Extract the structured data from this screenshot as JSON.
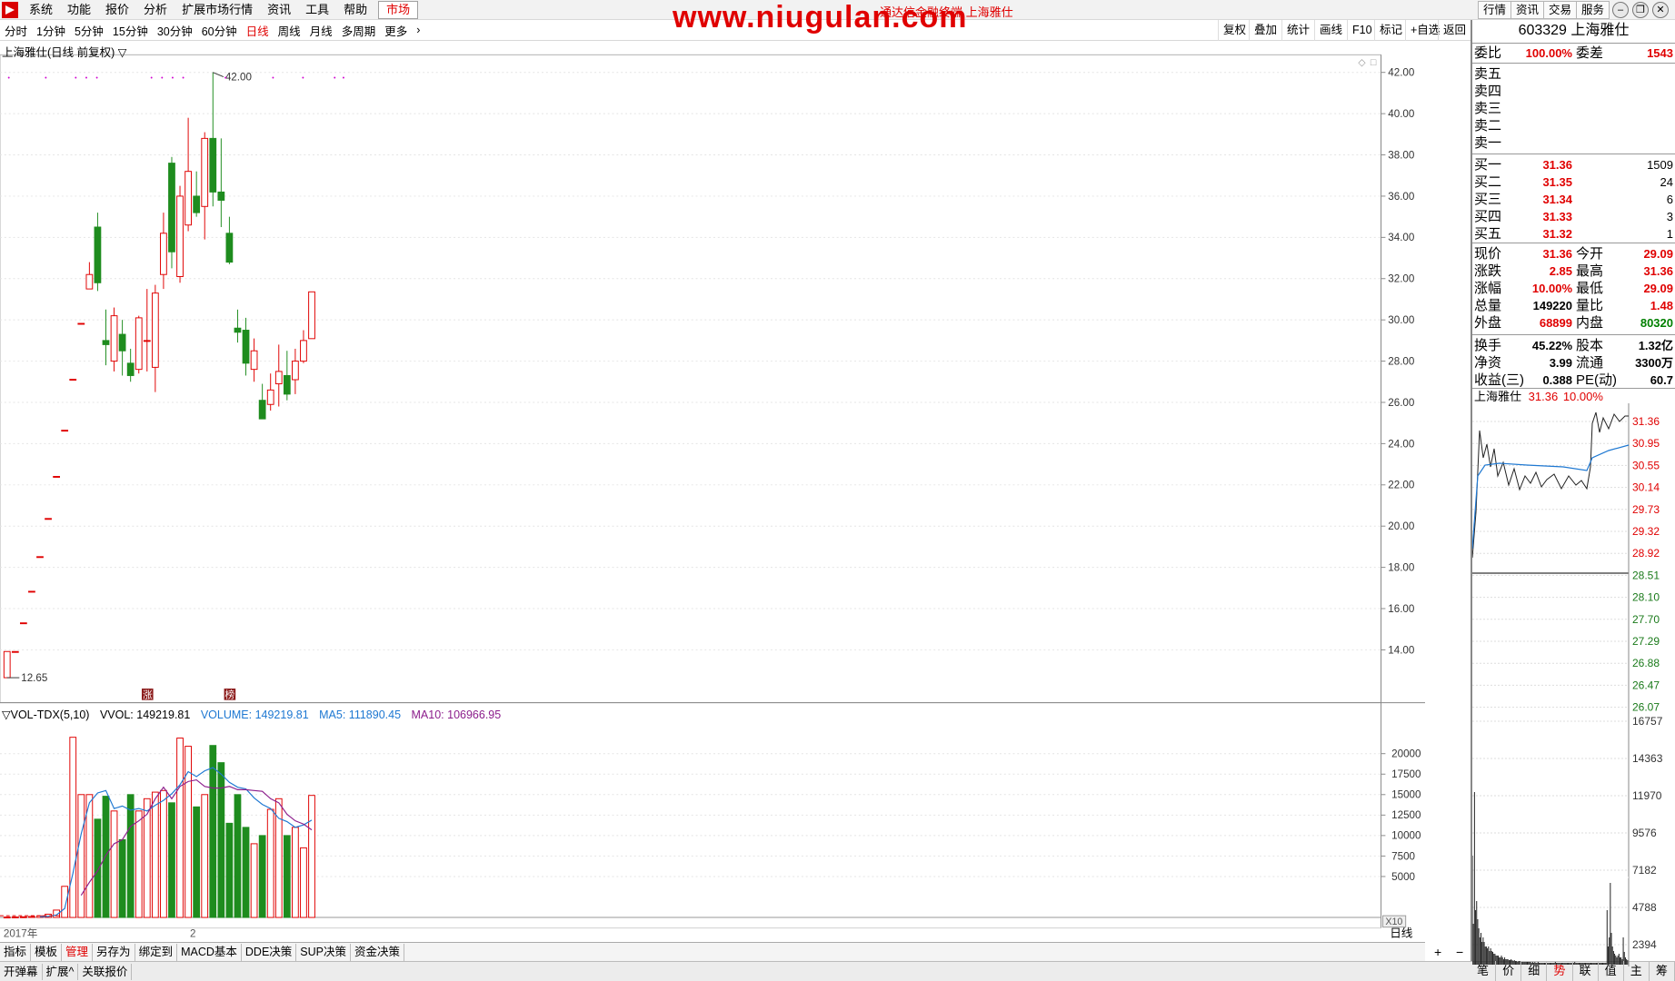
{
  "menu": {
    "items": [
      "系统",
      "功能",
      "报价",
      "分析",
      "扩展市场行情",
      "资讯",
      "工具",
      "帮助"
    ],
    "active": "市场",
    "watermark": "www.niugulan.com",
    "window_title": "通达信金融终端 上海雅仕",
    "right_buttons": [
      "行情",
      "资讯",
      "交易",
      "服务"
    ]
  },
  "periods": [
    "分时",
    "1分钟",
    "5分钟",
    "15分钟",
    "30分钟",
    "60分钟",
    "日线",
    "周线",
    "月线",
    "多周期",
    "更多"
  ],
  "selected_period": "日线",
  "toolbar": [
    "复权",
    "叠加",
    "统计",
    "画线",
    "F10",
    "标记",
    "+自选",
    "返回"
  ],
  "kline": {
    "title": "上海雅仕(日线 前复权)",
    "high_label": "42.00",
    "low_label": "12.65",
    "markers": [
      "涨",
      "榜"
    ],
    "date_label": "2017年",
    "month_label": "2",
    "yticks": [
      "42.00",
      "40.00",
      "38.00",
      "36.00",
      "34.00",
      "32.00",
      "30.00",
      "28.00",
      "26.00",
      "24.00",
      "22.00",
      "20.00",
      "18.00",
      "16.00",
      "14.00"
    ]
  },
  "volume": {
    "title": "VOL-TDX(5,10)",
    "vvol": "VVOL: 149219.81",
    "volume": "VOLUME: 149219.81",
    "ma5": "MA5: 111890.45",
    "ma10": "MA10: 106966.95",
    "yticks": [
      "20000",
      "17500",
      "15000",
      "12500",
      "10000",
      "7500",
      "5000"
    ],
    "unit": "X10",
    "period_label": "日线"
  },
  "chart_data": {
    "type": "candlestick",
    "candles": [
      {
        "o": 12.65,
        "c": 13.92,
        "h": 13.92,
        "l": 12.65
      },
      {
        "o": 13.92,
        "c": 13.92,
        "h": 13.92,
        "l": 13.92
      },
      {
        "o": 15.31,
        "c": 15.31,
        "h": 15.31,
        "l": 15.31
      },
      {
        "o": 16.84,
        "c": 16.84,
        "h": 16.84,
        "l": 16.84
      },
      {
        "o": 18.52,
        "c": 18.52,
        "h": 18.52,
        "l": 18.52
      },
      {
        "o": 20.37,
        "c": 20.37,
        "h": 20.37,
        "l": 20.37
      },
      {
        "o": 22.41,
        "c": 22.41,
        "h": 22.41,
        "l": 22.41
      },
      {
        "o": 24.65,
        "c": 24.65,
        "h": 24.65,
        "l": 24.65
      },
      {
        "o": 27.12,
        "c": 27.12,
        "h": 27.12,
        "l": 27.12
      },
      {
        "o": 29.83,
        "c": 29.83,
        "h": 29.83,
        "l": 29.83
      },
      {
        "o": 31.5,
        "c": 32.2,
        "h": 32.8,
        "l": 31.5
      },
      {
        "o": 34.5,
        "c": 31.8,
        "h": 35.2,
        "l": 31.4
      },
      {
        "o": 29.0,
        "c": 28.8,
        "h": 30.5,
        "l": 27.8
      },
      {
        "o": 28.0,
        "c": 30.2,
        "h": 30.6,
        "l": 27.5
      },
      {
        "o": 29.3,
        "c": 28.5,
        "h": 30.0,
        "l": 27.3
      },
      {
        "o": 27.9,
        "c": 27.3,
        "h": 28.6,
        "l": 27.0
      },
      {
        "o": 27.6,
        "c": 30.1,
        "h": 30.2,
        "l": 27.4
      },
      {
        "o": 29.0,
        "c": 29.0,
        "h": 31.5,
        "l": 27.5
      },
      {
        "o": 27.7,
        "c": 31.3,
        "h": 31.7,
        "l": 26.5
      },
      {
        "o": 32.2,
        "c": 34.2,
        "h": 35.2,
        "l": 31.5
      },
      {
        "o": 37.6,
        "c": 33.3,
        "h": 37.9,
        "l": 32.5
      },
      {
        "o": 32.1,
        "c": 36.0,
        "h": 36.5,
        "l": 31.8
      },
      {
        "o": 34.6,
        "c": 37.2,
        "h": 39.8,
        "l": 34.3
      },
      {
        "o": 36.0,
        "c": 35.2,
        "h": 37.2,
        "l": 35.0
      },
      {
        "o": 35.5,
        "c": 38.8,
        "h": 39.1,
        "l": 33.9
      },
      {
        "o": 38.8,
        "c": 36.2,
        "h": 42.0,
        "l": 35.5
      },
      {
        "o": 36.2,
        "c": 35.8,
        "h": 38.8,
        "l": 34.5
      },
      {
        "o": 34.2,
        "c": 32.8,
        "h": 35.0,
        "l": 32.7
      },
      {
        "o": 29.6,
        "c": 29.4,
        "h": 30.5,
        "l": 28.9
      },
      {
        "o": 29.5,
        "c": 27.9,
        "h": 30.1,
        "l": 27.3
      },
      {
        "o": 27.6,
        "c": 28.5,
        "h": 29.1,
        "l": 27.0
      },
      {
        "o": 26.1,
        "c": 25.2,
        "h": 26.9,
        "l": 25.2
      },
      {
        "o": 25.9,
        "c": 26.6,
        "h": 27.4,
        "l": 25.6
      },
      {
        "o": 26.9,
        "c": 27.5,
        "h": 28.8,
        "l": 25.8
      },
      {
        "o": 27.3,
        "c": 26.4,
        "h": 28.5,
        "l": 26.1
      },
      {
        "o": 27.1,
        "c": 28.0,
        "h": 28.6,
        "l": 26.4
      },
      {
        "o": 28.0,
        "c": 29.0,
        "h": 29.5,
        "l": 27.9
      },
      {
        "o": 29.09,
        "c": 31.36,
        "h": 31.36,
        "l": 29.09
      }
    ],
    "volumes": [
      50,
      60,
      80,
      120,
      200,
      400,
      900,
      3800,
      22000,
      15000,
      15000,
      12000,
      14800,
      13000,
      9500,
      15000,
      13000,
      14500,
      15300,
      15500,
      14000,
      21900,
      20900,
      13500,
      15000,
      21000,
      18900,
      11500,
      15000,
      11000,
      9000,
      10000,
      13200,
      14500,
      10000,
      11000,
      8500,
      14900
    ],
    "ma5": [
      null,
      null,
      null,
      null,
      80,
      130,
      300,
      1100,
      5400,
      10200,
      14000,
      15200,
      15500,
      13300,
      13600,
      13100,
      13300,
      13000,
      13700,
      14300,
      15100,
      16200,
      17800,
      17200,
      17900,
      18300,
      17500,
      16500,
      15900,
      15700,
      14600,
      13800,
      13300,
      12100,
      11700,
      11000,
      11300,
      11890
    ],
    "ma10": [
      null,
      null,
      null,
      null,
      null,
      null,
      null,
      null,
      null,
      2700,
      4300,
      5700,
      7600,
      9000,
      9500,
      11100,
      11800,
      12600,
      14500,
      15900,
      14500,
      16000,
      16600,
      16800,
      16000,
      15800,
      15800,
      16000,
      15600,
      15600,
      15500,
      15400,
      14500,
      14000,
      12600,
      11800,
      11400,
      10697
    ],
    "ylim": [
      12,
      43
    ]
  },
  "quote": {
    "code": "603329",
    "name": "上海雅仕",
    "weibi_label": "委比",
    "weibi": "100.00%",
    "weicha_label": "委差",
    "weicha": "1543",
    "sell_labels": [
      "卖五",
      "卖四",
      "卖三",
      "卖二",
      "卖一"
    ],
    "buy": [
      {
        "label": "买一",
        "price": "31.36",
        "vol": "1509"
      },
      {
        "label": "买二",
        "price": "31.35",
        "vol": "24"
      },
      {
        "label": "买三",
        "price": "31.34",
        "vol": "6"
      },
      {
        "label": "买四",
        "price": "31.33",
        "vol": "3"
      },
      {
        "label": "买五",
        "price": "31.32",
        "vol": "1"
      }
    ],
    "stats": [
      {
        "l1": "现价",
        "v1": "31.36",
        "c1": "red",
        "l2": "今开",
        "v2": "29.09",
        "c2": "red"
      },
      {
        "l1": "涨跌",
        "v1": "2.85",
        "c1": "red",
        "l2": "最高",
        "v2": "31.36",
        "c2": "red"
      },
      {
        "l1": "涨幅",
        "v1": "10.00%",
        "c1": "red",
        "l2": "最低",
        "v2": "29.09",
        "c2": "red"
      },
      {
        "l1": "总量",
        "v1": "149220",
        "c1": "blk",
        "l2": "量比",
        "v2": "1.48",
        "c2": "red"
      },
      {
        "l1": "外盘",
        "v1": "68899",
        "c1": "red",
        "l2": "内盘",
        "v2": "80320",
        "c2": "green"
      }
    ],
    "stats2": [
      {
        "l1": "换手",
        "v1": "45.22%",
        "l2": "股本",
        "v2": "1.32亿"
      },
      {
        "l1": "净资",
        "v1": "3.99",
        "l2": "流通",
        "v2": "3300万"
      },
      {
        "l1": "收益(三)",
        "v1": "0.388",
        "l2": "PE(动)",
        "v2": "60.7"
      }
    ]
  },
  "intraday": {
    "name": "上海雅仕",
    "price": "31.36",
    "pct": "10.00%",
    "price_ticks": [
      "31.36",
      "30.95",
      "30.55",
      "30.14",
      "29.73",
      "29.32",
      "28.92",
      "28.51",
      "28.10",
      "27.70",
      "27.29",
      "26.88",
      "26.47",
      "26.07"
    ],
    "vol_ticks": [
      "16757",
      "14363",
      "11970",
      "9576",
      "7182",
      "4788",
      "2394"
    ]
  },
  "bottom_tabs": [
    "指标",
    "模板",
    "管理",
    "另存为",
    "绑定到",
    "MACD基本",
    "DDE决策",
    "SUP决策",
    "资金决策"
  ],
  "bottom_selected": "管理",
  "status_items": [
    "开弹幕",
    "扩展^",
    "关联报价"
  ],
  "right_tabs": [
    "笔",
    "价",
    "细",
    "势",
    "联",
    "值",
    "主",
    "筹"
  ],
  "right_selected": "势",
  "colors": {
    "up": "#e00000",
    "down": "#1e8c1e",
    "ma5": "#1e78d2",
    "ma10": "#8c1e8c"
  }
}
